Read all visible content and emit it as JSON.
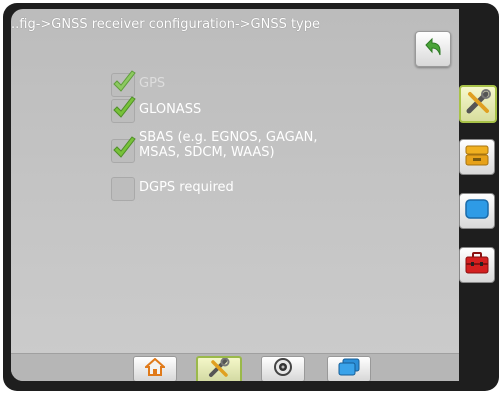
{
  "header": {
    "title": "..fig->GNSS receiver configuration->GNSS type"
  },
  "options": [
    {
      "label": "GPS",
      "checked": true,
      "enabled": false
    },
    {
      "label": "GLONASS",
      "checked": true,
      "enabled": true
    },
    {
      "label": "SBAS (e.g. EGNOS, GAGAN,\nMSAS, SDCM, WAAS)",
      "checked": true,
      "enabled": true
    },
    {
      "label": "DGPS required",
      "checked": false,
      "enabled": true
    }
  ],
  "bottom_tabs": [
    {
      "icon": "home-icon",
      "active": false
    },
    {
      "icon": "tools-icon",
      "active": true
    },
    {
      "icon": "guidance-icon",
      "active": false
    },
    {
      "icon": "data-icon",
      "active": false
    }
  ],
  "side_tabs": [
    {
      "icon": "tools-icon",
      "active": true
    },
    {
      "icon": "console-icon",
      "active": false
    },
    {
      "icon": "screen-icon",
      "active": false
    },
    {
      "icon": "toolbox-icon",
      "active": false
    }
  ],
  "colors": {
    "check_green": "#78c23a",
    "active_border": "#a8c248",
    "screen_bg": "#c2c2c2"
  }
}
